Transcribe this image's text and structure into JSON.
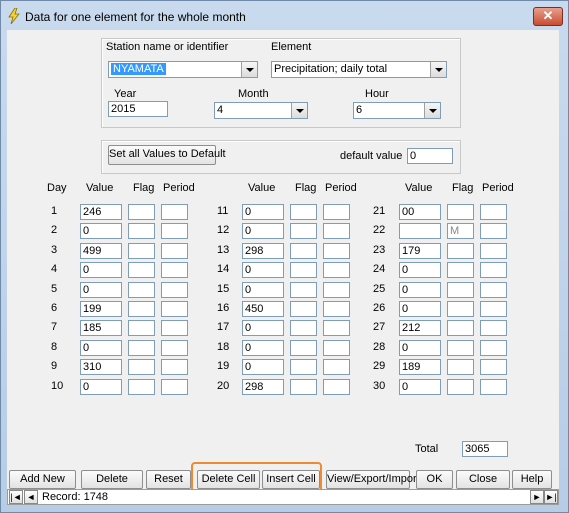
{
  "window": {
    "title": "Data for one element for the whole month",
    "close_glyph": "✕"
  },
  "header": {
    "station_label": "Station name or identifier",
    "station_value": "NYAMATA",
    "element_label": "Element",
    "element_value": "Precipitation; daily total",
    "year_label": "Year",
    "year_value": "2015",
    "month_label": "Month",
    "month_value": "4",
    "hour_label": "Hour",
    "hour_value": "6"
  },
  "defaults": {
    "set_all_label": "Set all Values to Default",
    "default_value_label": "default value",
    "default_value": "0"
  },
  "columns": {
    "day": "Day",
    "value": "Value",
    "flag": "Flag",
    "period": "Period"
  },
  "days": [
    {
      "day": "1",
      "value": "246",
      "flag": "",
      "period": ""
    },
    {
      "day": "2",
      "value": "0",
      "flag": "",
      "period": ""
    },
    {
      "day": "3",
      "value": "499",
      "flag": "",
      "period": ""
    },
    {
      "day": "4",
      "value": "0",
      "flag": "",
      "period": ""
    },
    {
      "day": "5",
      "value": "0",
      "flag": "",
      "period": ""
    },
    {
      "day": "6",
      "value": "199",
      "flag": "",
      "period": ""
    },
    {
      "day": "7",
      "value": "185",
      "flag": "",
      "period": ""
    },
    {
      "day": "8",
      "value": "0",
      "flag": "",
      "period": ""
    },
    {
      "day": "9",
      "value": "310",
      "flag": "",
      "period": ""
    },
    {
      "day": "10",
      "value": "0",
      "flag": "",
      "period": ""
    },
    {
      "day": "11",
      "value": "0",
      "flag": "",
      "period": ""
    },
    {
      "day": "12",
      "value": "0",
      "flag": "",
      "period": ""
    },
    {
      "day": "13",
      "value": "298",
      "flag": "",
      "period": ""
    },
    {
      "day": "14",
      "value": "0",
      "flag": "",
      "period": ""
    },
    {
      "day": "15",
      "value": "0",
      "flag": "",
      "period": ""
    },
    {
      "day": "16",
      "value": "450",
      "flag": "",
      "period": ""
    },
    {
      "day": "17",
      "value": "0",
      "flag": "",
      "period": ""
    },
    {
      "day": "18",
      "value": "0",
      "flag": "",
      "period": ""
    },
    {
      "day": "19",
      "value": "0",
      "flag": "",
      "period": ""
    },
    {
      "day": "20",
      "value": "298",
      "flag": "",
      "period": ""
    },
    {
      "day": "21",
      "value": "00",
      "flag": "",
      "period": ""
    },
    {
      "day": "22",
      "value": "",
      "flag": "M",
      "period": ""
    },
    {
      "day": "23",
      "value": "179",
      "flag": "",
      "period": ""
    },
    {
      "day": "24",
      "value": "0",
      "flag": "",
      "period": ""
    },
    {
      "day": "25",
      "value": "0",
      "flag": "",
      "period": ""
    },
    {
      "day": "26",
      "value": "0",
      "flag": "",
      "period": ""
    },
    {
      "day": "27",
      "value": "212",
      "flag": "",
      "period": ""
    },
    {
      "day": "28",
      "value": "0",
      "flag": "",
      "period": ""
    },
    {
      "day": "29",
      "value": "189",
      "flag": "",
      "period": ""
    },
    {
      "day": "30",
      "value": "0",
      "flag": "",
      "period": ""
    }
  ],
  "total": {
    "label": "Total",
    "value": "3065"
  },
  "buttons": {
    "add_new": "Add New",
    "delete": "Delete",
    "reset": "Reset",
    "delete_cell": "Delete Cell",
    "insert_cell": "Insert Cell",
    "view_export": "View/Export/Import",
    "ok": "OK",
    "close": "Close",
    "help": "Help"
  },
  "navigator": {
    "record_label": "Record: 1748",
    "first": "|◄",
    "prev": "◄",
    "next": "►",
    "last": "►|"
  },
  "colors": {
    "highlight": "#f08a30",
    "selection": "#3399ff"
  }
}
